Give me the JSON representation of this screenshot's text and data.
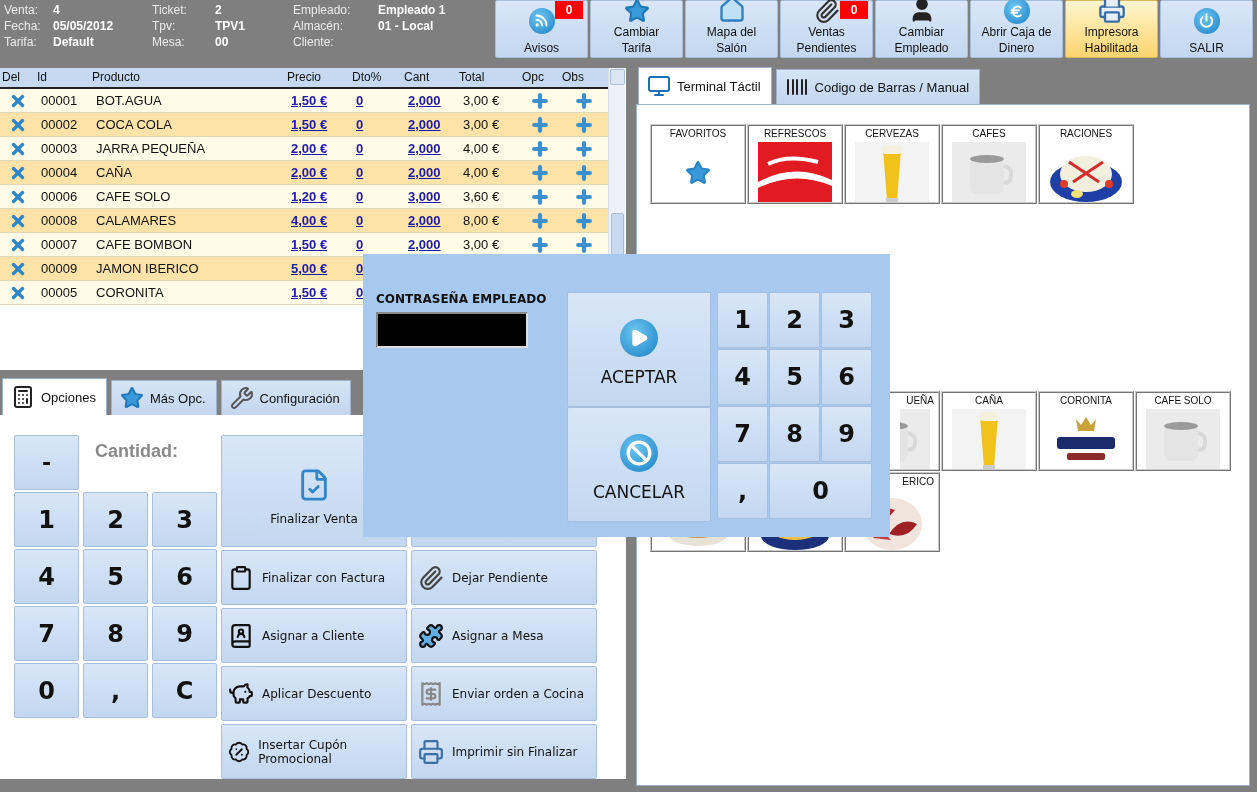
{
  "info": [
    {
      "label": "Venta:",
      "value": "4"
    },
    {
      "label": "Ticket:",
      "value": "2"
    },
    {
      "label": "Empleado:",
      "value": "Empleado 1"
    },
    {
      "label": "Fecha:",
      "value": "05/05/2012"
    },
    {
      "label": "Tpv:",
      "value": "TPV1"
    },
    {
      "label": "Almacén:",
      "value": "01 - Local"
    },
    {
      "label": "Tarifa:",
      "value": "Default"
    },
    {
      "label": "Mesa:",
      "value": "00"
    },
    {
      "label": "Cliente:"
    }
  ],
  "toolbar": {
    "buttons": [
      {
        "lines": [
          "Avisos"
        ],
        "badge": "0",
        "on": false
      },
      {
        "lines": [
          "Cambiar",
          "Tarifa"
        ],
        "on": false
      },
      {
        "lines": [
          "Mapa del",
          "Salón"
        ],
        "on": false
      },
      {
        "lines": [
          "Ventas",
          "Pendientes"
        ],
        "badge": "0",
        "on": false
      },
      {
        "lines": [
          "Cambiar",
          "Empleado"
        ],
        "on": false
      },
      {
        "lines": [
          "Abrir Caja de",
          "Dinero"
        ],
        "on": false
      },
      {
        "lines": [
          "Impresora",
          "Habilitada"
        ],
        "on": true
      },
      {
        "lines": [
          "SALIR"
        ],
        "on": false
      }
    ]
  },
  "table": {
    "columns": [
      "Del",
      "Id",
      "Producto",
      "Precio",
      "Dto%",
      "Cant",
      "Total",
      "Opc",
      "Obs"
    ],
    "rows": [
      {
        "id": "00001",
        "product": "BOT.AGUA",
        "price": "1,50 €",
        "discount": "0",
        "quantity": "2,000",
        "total": "3,00 €"
      },
      {
        "id": "00002",
        "product": "COCA COLA",
        "price": "1,50 €",
        "discount": "0",
        "quantity": "2,000",
        "total": "3,00 €"
      },
      {
        "id": "00003",
        "product": "JARRA PEQUEÑA",
        "price": "2,00 €",
        "discount": "0",
        "quantity": "2,000",
        "total": "4,00 €"
      },
      {
        "id": "00004",
        "product": "CAÑA",
        "price": "2,00 €",
        "discount": "0",
        "quantity": "2,000",
        "total": "4,00 €"
      },
      {
        "id": "00006",
        "product": "CAFE SOLO",
        "price": "1,20 €",
        "discount": "0",
        "quantity": "3,000",
        "total": "3,60 €"
      },
      {
        "id": "00008",
        "product": "CALAMARES",
        "price": "4,00 €",
        "discount": "0",
        "quantity": "2,000",
        "total": "8,00 €"
      },
      {
        "id": "00007",
        "product": "CAFE BOMBON",
        "price": "1,50 €",
        "discount": "0",
        "quantity": "2,000",
        "total": "3,00 €"
      },
      {
        "id": "00009",
        "product": "JAMON IBERICO",
        "price": "5,00 €",
        "discount": "0"
      },
      {
        "id": "00005",
        "product": "CORONITA",
        "price": "1,50 €",
        "discount": "0"
      }
    ]
  },
  "options_tabs": [
    {
      "label": "Opciones",
      "selected": true
    },
    {
      "label": "Más Opc.",
      "selected": false
    },
    {
      "label": "Configuración",
      "selected": false
    }
  ],
  "keypad": {
    "minus": "-",
    "quantity_label": "Cantidad:",
    "keys": [
      "1",
      "2",
      "3",
      "4",
      "5",
      "6",
      "7",
      "8",
      "9",
      "0",
      ",",
      "C"
    ]
  },
  "actions": [
    {
      "label": "Finalizar Venta",
      "kind": "big"
    },
    {
      "kind": "big"
    },
    {
      "label": "Finalizar con Factura",
      "kind": "small"
    },
    {
      "label": "Dejar Pendiente",
      "kind": "small"
    },
    {
      "label": "Asignar a Cliente",
      "kind": "small"
    },
    {
      "label": "Asignar a Mesa",
      "kind": "small"
    },
    {
      "label": "Aplicar Descuento",
      "kind": "small"
    },
    {
      "label": "Enviar orden a Cocina",
      "kind": "small"
    },
    {
      "label": "Insertar Cupón Promocional",
      "kind": "small"
    },
    {
      "label": "Imprimir sin Finalizar",
      "kind": "small"
    }
  ],
  "product_tabs": [
    {
      "label": "Terminal Táctil",
      "selected": true
    },
    {
      "label": "Codigo de Barras / Manual",
      "selected": false
    }
  ],
  "categories": [
    {
      "label": "FAVORITOS",
      "kind": "icon"
    },
    {
      "label": "REFRESCOS",
      "kind": "picture"
    },
    {
      "label": "CERVEZAS",
      "kind": "picture"
    },
    {
      "label": "CAFES",
      "kind": "picture"
    },
    {
      "label": "RACIONES",
      "kind": "picture"
    }
  ],
  "products": [
    [
      {
        "label": "UEÑA",
        "cut": true,
        "kind": "picture"
      },
      {
        "label": "CAÑA",
        "cut": false,
        "kind": "picture"
      },
      {
        "label": "CORONITA",
        "cut": false,
        "kind": "picture"
      },
      {
        "label": "CAFE SOLO",
        "cut": false,
        "kind": "picture"
      }
    ],
    [
      {
        "kind": "picture"
      },
      {
        "kind": "picture"
      },
      {
        "label": "ERICO",
        "cut": true,
        "kind": "picture"
      }
    ]
  ],
  "dialog": {
    "title": "CONTRASEÑA EMPLEADO",
    "accept": "ACEPTAR",
    "cancel": "CANCELAR",
    "keys": [
      "1",
      "2",
      "3",
      "4",
      "5",
      "6",
      "7",
      "8",
      "9",
      ",",
      "0"
    ]
  }
}
